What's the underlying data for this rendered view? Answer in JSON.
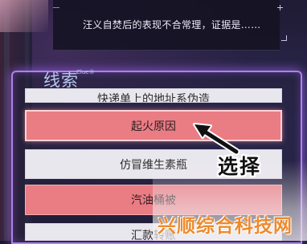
{
  "dialog": {
    "text": "汪义自焚后的表现不合常理，证据是……"
  },
  "clues": {
    "title": "线索",
    "subtitle": "Clue®",
    "items": [
      {
        "label": "快递单上的地址系伪造",
        "state": "normal"
      },
      {
        "label": "起火原因",
        "state": "selected"
      },
      {
        "label": "仿冒维生素瓶",
        "state": "normal"
      },
      {
        "label": "汽油桶被",
        "state": "highlighted"
      },
      {
        "label": "汇款转账",
        "state": "normal"
      }
    ]
  },
  "annotation": {
    "text": "选择"
  },
  "watermark": {
    "text": "兴顺综合科技网"
  },
  "colors": {
    "selected": "#ea7c84",
    "normal": "#e9e7ee",
    "panel_glow": "#be8cff",
    "watermark": "#ee8a2b"
  }
}
